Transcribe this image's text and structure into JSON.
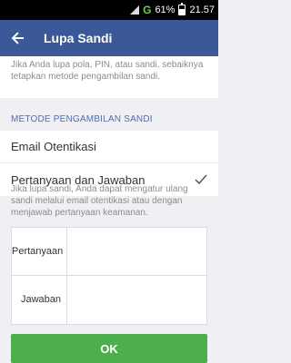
{
  "status_bar": {
    "network": "G",
    "battery_percent": "61%",
    "time": "21.57"
  },
  "app_bar": {
    "title": "Lupa Sandi",
    "back_icon": "arrow-left-icon"
  },
  "intro_text": "Jika Anda lupa pola, PIN, atau sandi, sebaiknya tetapkan metode pengambilan sandi.",
  "method_section": {
    "title": "METODE PENGAMBILAN SANDI",
    "options": [
      {
        "label": "Email Otentikasi",
        "selected": false
      },
      {
        "label": "Pertanyaan dan Jawaban",
        "selected": true
      }
    ]
  },
  "help_text": "Jika lupa sandi, Anda dapat mengatur ulang sandi melalui email otentikasi atau dengan menjawab pertanyaan keamanan.",
  "qa_form": {
    "question_label": "Pertanyaan",
    "question_value": "",
    "answer_label": "Jawaban",
    "answer_value": ""
  },
  "ok_button": "OK",
  "colors": {
    "app_bar": "#3b5998",
    "section_title": "#4e6eb2",
    "ok_button": "#4cae4c"
  }
}
